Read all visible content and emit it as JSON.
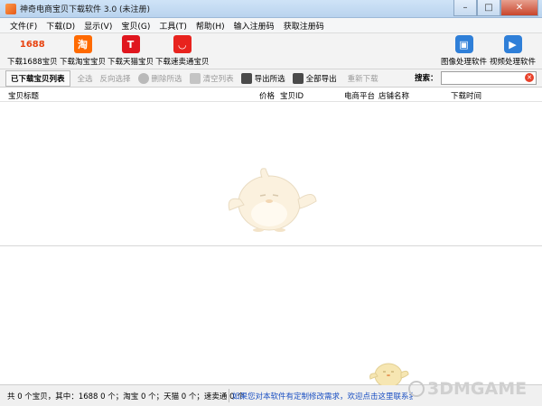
{
  "window": {
    "title": "神奇电商宝贝下载软件 3.0 (未注册)",
    "controls": [
      "–",
      "□",
      "✕"
    ]
  },
  "menu": [
    "文件(F)",
    "下载(D)",
    "显示(V)",
    "宝贝(G)",
    "工具(T)",
    "帮助(H)",
    "输入注册码",
    "获取注册码"
  ],
  "toolbar": {
    "download_1688": {
      "label": "下载1688宝贝",
      "icon": "1688-logo-icon",
      "glyph": "1688"
    },
    "download_taobao": {
      "label": "下载淘宝宝贝",
      "icon": "taobao-icon",
      "glyph": "淘"
    },
    "download_tmall": {
      "label": "下载天猫宝贝",
      "icon": "tmall-icon",
      "glyph": "T"
    },
    "download_sumaitong": {
      "label": "下载速卖通宝贝",
      "icon": "aliexpress-icon",
      "glyph": "◡"
    },
    "image_software": {
      "label": "图像处理软件",
      "icon": "image-icon",
      "glyph": "▣"
    },
    "video_software": {
      "label": "视频处理软件",
      "icon": "video-icon",
      "glyph": "▶"
    }
  },
  "actions": {
    "downloaded_list": "已下载宝贝列表",
    "select_all": "全选",
    "invert_select": "反向选择",
    "delete_selected": "删除所选",
    "clear_list": "清空列表",
    "export_selected": "导出所选",
    "export_all": "全部导出",
    "re_download": "重新下载",
    "search_label": "搜索：",
    "search_value": "",
    "search_clear": "✕"
  },
  "table": {
    "columns": [
      "宝贝标题",
      "价格",
      "宝贝ID",
      "电商平台",
      "店铺名称",
      "下载时间"
    ],
    "rows": []
  },
  "status": {
    "summary": "共 0 个宝贝，其中：1688 0 个；淘宝 0 个；天猫 0 个；速卖通 0 个",
    "notice": "如果您对本软件有定制修改需求，欢迎点击这里联系我们"
  },
  "watermark": {
    "text": "3DMGAME"
  },
  "colors": {
    "accent": "#2f7fd8",
    "tmall_red": "#e0161e",
    "taobao_orange": "#ff6a00",
    "link_blue": "#1a4fc2"
  }
}
